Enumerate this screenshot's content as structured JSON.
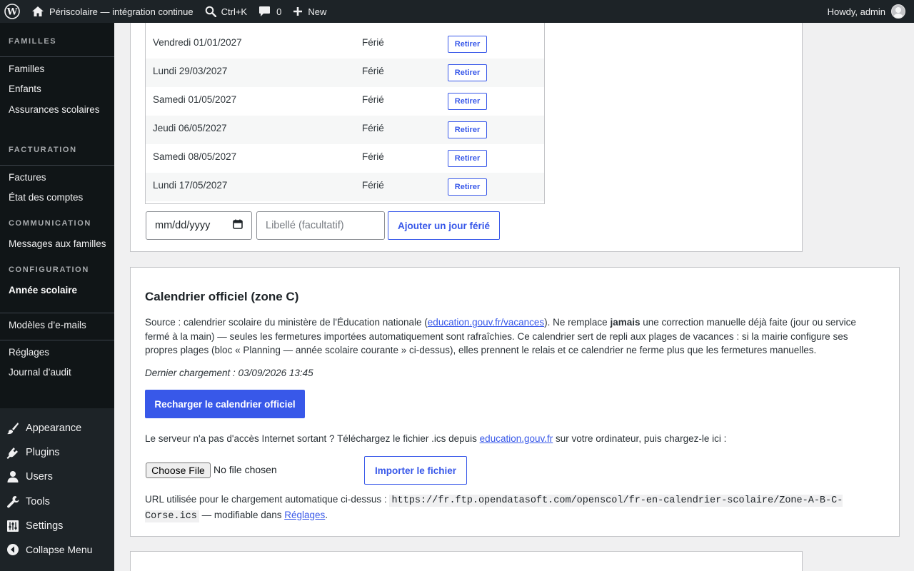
{
  "admin_bar": {
    "site_name": "Périscolaire — intégration continue",
    "search_shortcut": "Ctrl+K",
    "comments_count": "0",
    "new_label": "New",
    "howdy": "Howdy, admin"
  },
  "sidebar": {
    "sections": [
      {
        "heading": "FAMILLES",
        "items": [
          "Familles",
          "Enfants",
          "Assurances scolaires"
        ]
      },
      {
        "heading": "FACTURATION",
        "items": [
          "Factures",
          "État des comptes"
        ]
      },
      {
        "heading": "COMMUNICATION",
        "items": [
          "Messages aux familles"
        ]
      },
      {
        "heading": "CONFIGURATION",
        "items": [
          "Année scolaire"
        ]
      }
    ],
    "extra_items": [
      "Modèles d’e-mails",
      "Réglages",
      "Journal d’audit"
    ],
    "menu": [
      "Appearance",
      "Plugins",
      "Users",
      "Tools",
      "Settings",
      "Collapse Menu"
    ]
  },
  "holidays": {
    "rows": [
      {
        "date": "Vendredi 01/01/2027",
        "type": "Férié",
        "action": "Retirer"
      },
      {
        "date": "Lundi 29/03/2027",
        "type": "Férié",
        "action": "Retirer"
      },
      {
        "date": "Samedi 01/05/2027",
        "type": "Férié",
        "action": "Retirer"
      },
      {
        "date": "Jeudi 06/05/2027",
        "type": "Férié",
        "action": "Retirer"
      },
      {
        "date": "Samedi 08/05/2027",
        "type": "Férié",
        "action": "Retirer"
      },
      {
        "date": "Lundi 17/05/2027",
        "type": "Férié",
        "action": "Retirer"
      }
    ],
    "date_placeholder": "mm/dd/yyyy",
    "label_placeholder": "Libellé (facultatif)",
    "add_button": "Ajouter un jour férié"
  },
  "official_calendar": {
    "title": "Calendrier officiel (zone C)",
    "desc_1": "Source : calendrier scolaire du ministère de l'Éducation nationale (",
    "desc_link": "education.gouv.fr/vacances",
    "desc_2": "). Ne remplace ",
    "desc_bold": "jamais",
    "desc_3": " une correction manuelle déjà faite (jour ou service fermé à la main) — seules les fermetures importées automatiquement sont rafraîchies. Ce calendrier sert de repli aux plages de vacances : si la mairie configure ses propres plages (bloc « Planning — année scolaire courante » ci-dessus), elles prennent le relais et ce calendrier ne ferme plus que les fermetures manuelles.",
    "last_load": "Dernier chargement : 03/09/2026 13:45",
    "reload_button": "Recharger le calendrier officiel",
    "offline_1": "Le serveur n'a pas d'accès Internet sortant ? Téléchargez le fichier .ics depuis ",
    "offline_link": "education.gouv.fr",
    "offline_2": " sur votre ordinateur, puis chargez-le ici :",
    "choose_file": "Choose File",
    "no_file": "No file chosen",
    "import_button": "Importer le fichier",
    "url_label": "URL utilisée pour le chargement automatique ci-dessus : ",
    "url": "https://fr.ftp.opendatasoft.com/openscol/fr-en-calendrier-scolaire/Zone-A-B-C-Corse.ics",
    "url_suffix": " — modifiable dans ",
    "settings_link": "Réglages",
    "period": "."
  }
}
